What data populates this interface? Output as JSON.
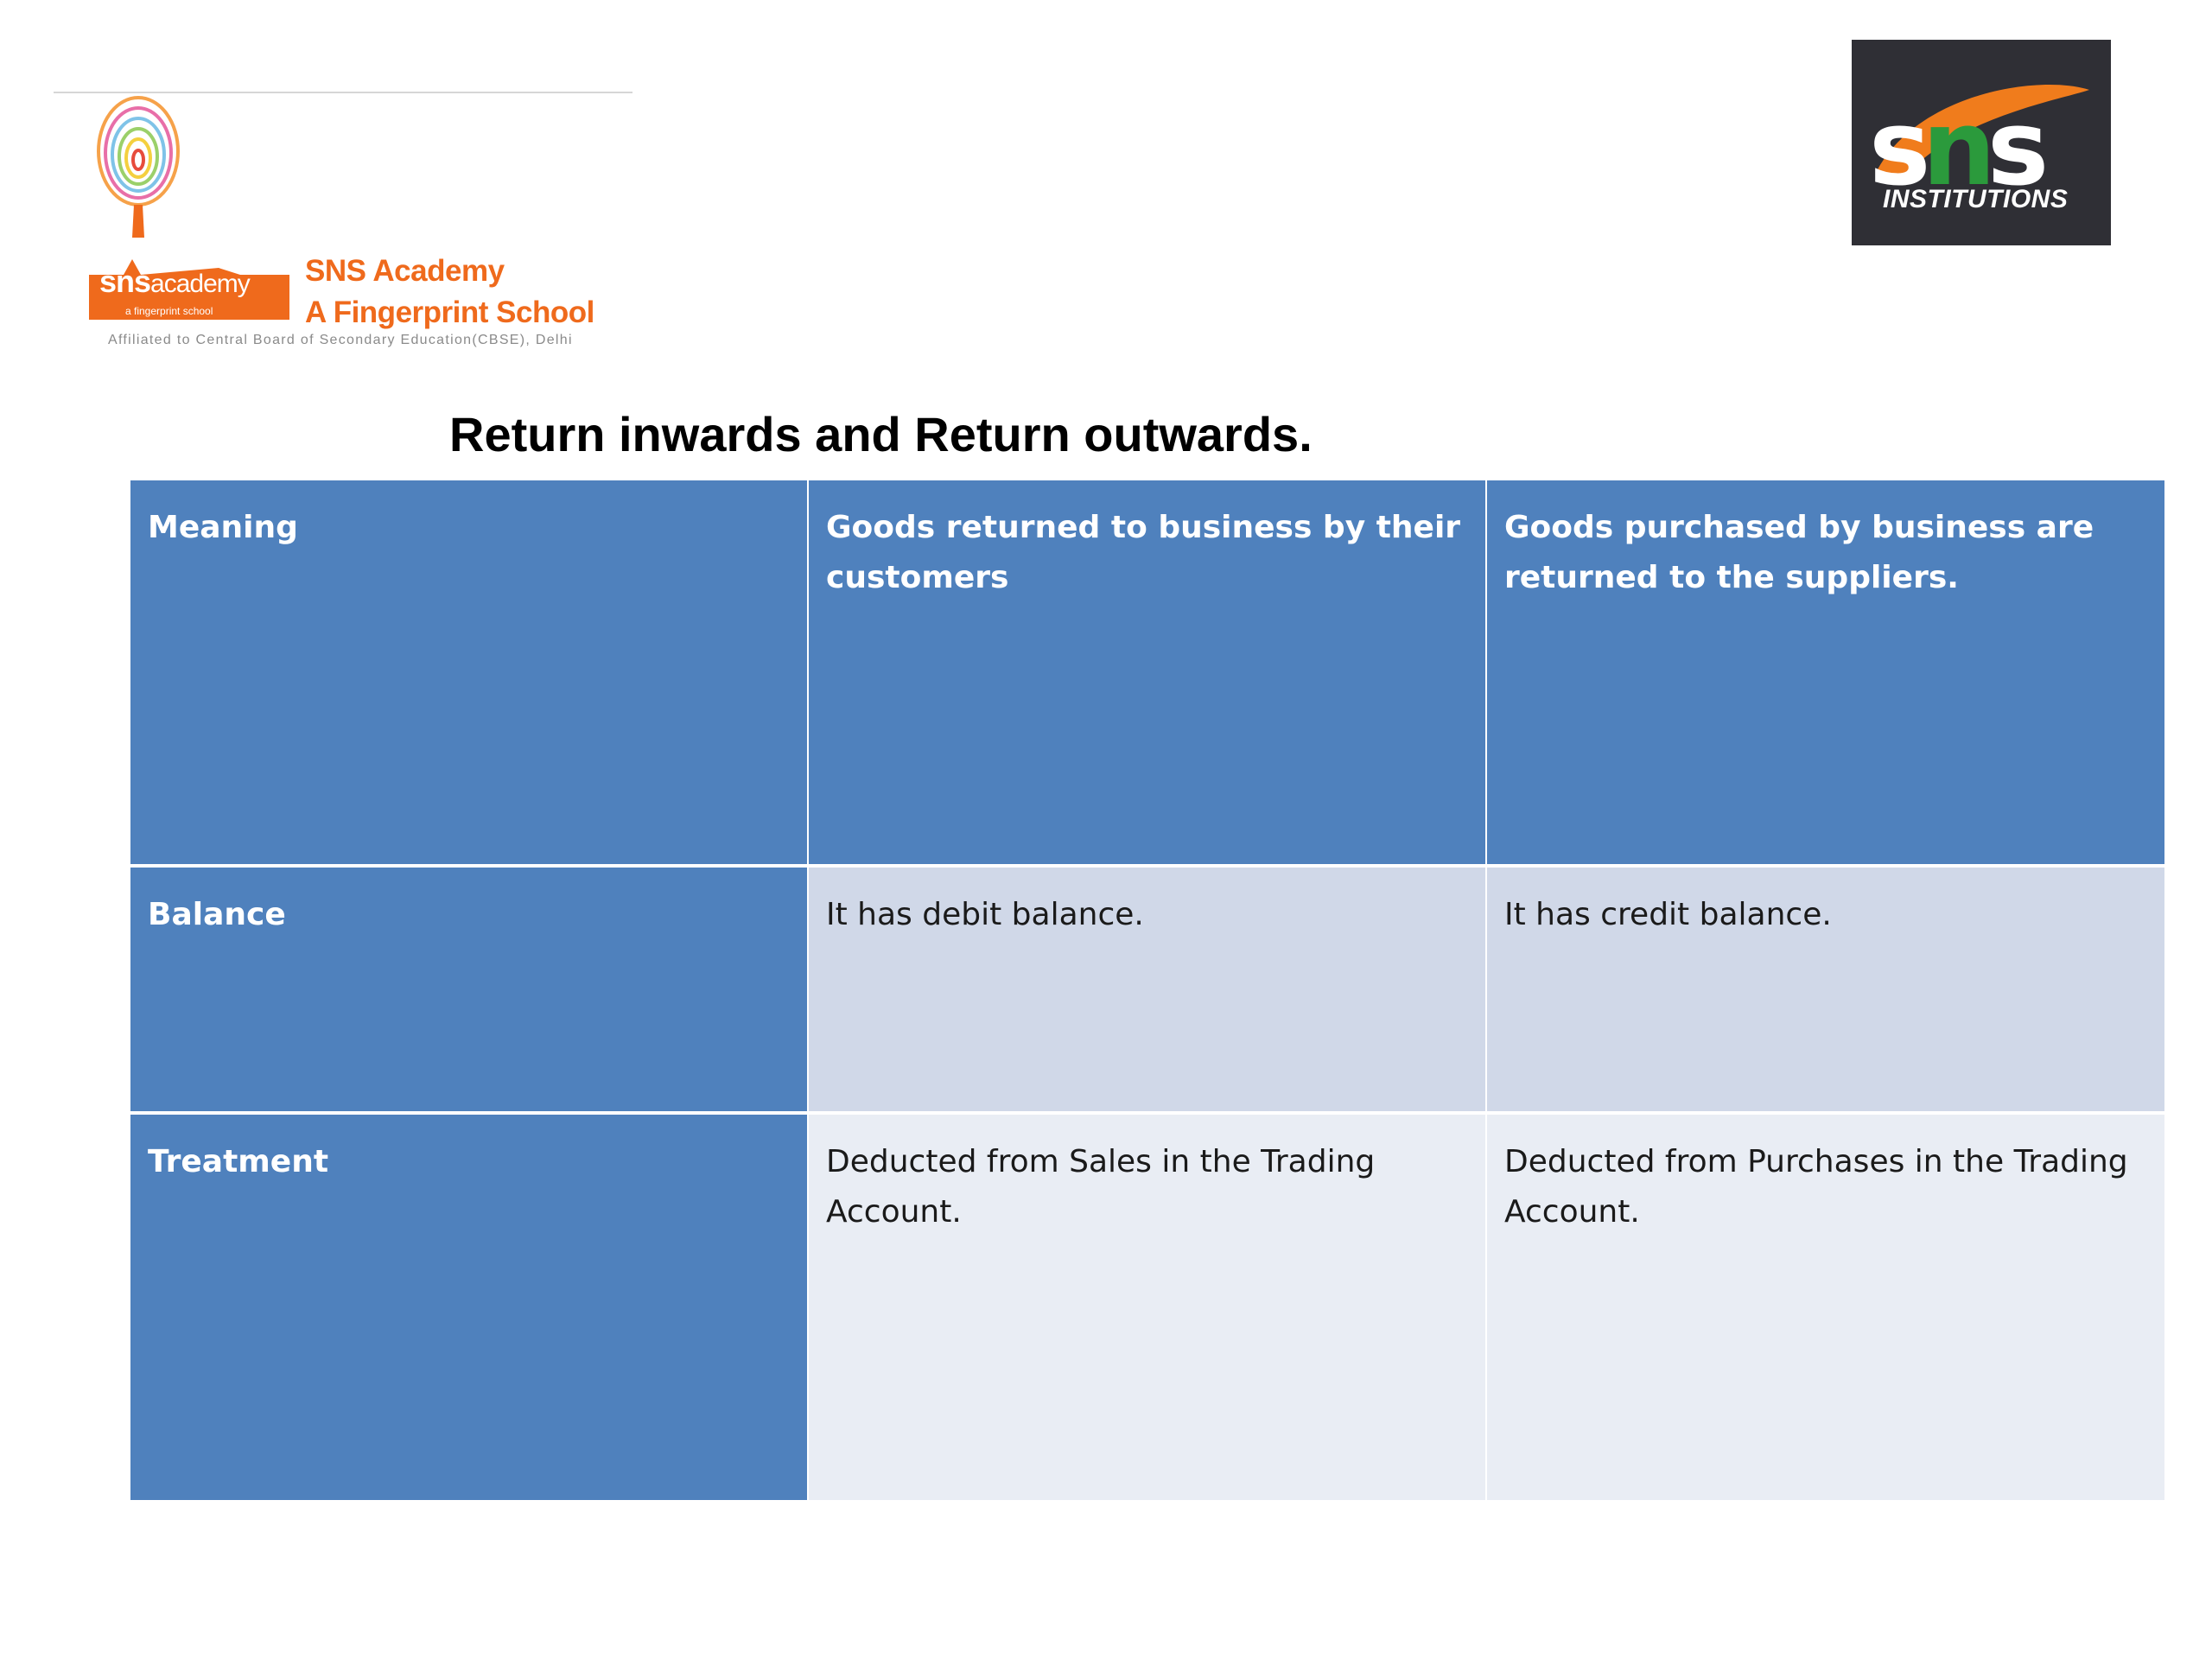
{
  "header": {
    "academy_logo": {
      "badge_text": "sns",
      "badge_sub": "academy",
      "badge_tag": "a fingerprint school",
      "name_line1": "SNS Academy",
      "name_line2": "A Fingerprint School",
      "affiliation": "Affiliated to Central Board of Secondary Education(CBSE), Delhi"
    },
    "institutions_logo": {
      "letter_s1": "s",
      "letter_n": "n",
      "letter_s2": "s",
      "word": "INSTITUTIONS"
    }
  },
  "title": "Return inwards and Return outwards.",
  "table": {
    "rows": [
      {
        "label": "Meaning",
        "return_inwards": "Goods returned to business by their customers",
        "return_outwards": "Goods purchased by business are returned to the suppliers."
      },
      {
        "label": "Balance",
        "return_inwards": "It has debit balance.",
        "return_outwards": "It has credit balance."
      },
      {
        "label": "Treatment",
        "return_inwards": "Deducted from Sales in the Trading Account.",
        "return_outwards": "Deducted from Purchases in the Trading Account."
      }
    ]
  },
  "colors": {
    "header_blue": "#4f81bd",
    "balance_row": "#d0d8e8",
    "treatment_row": "#e9edf4",
    "academy_orange": "#ef6a1c",
    "inst_dark": "#2f2f35",
    "inst_green": "#2b9a3c"
  }
}
